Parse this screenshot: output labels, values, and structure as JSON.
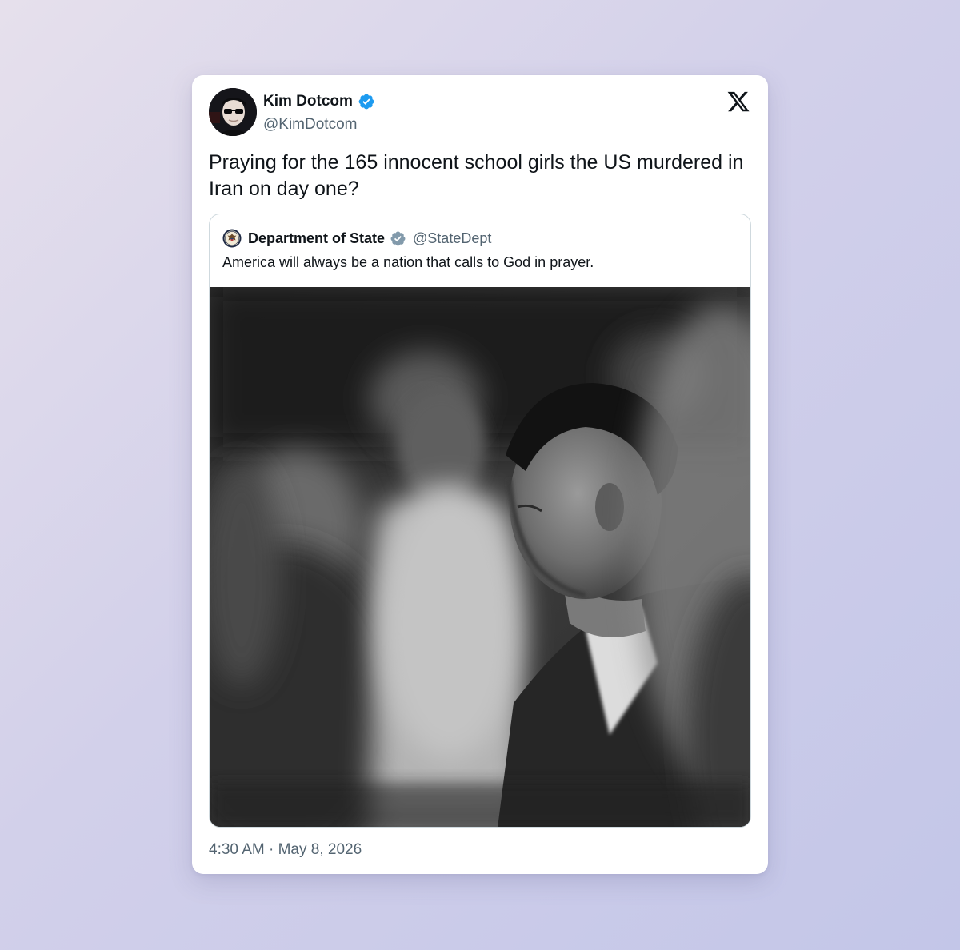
{
  "author": {
    "name": "Kim Dotcom",
    "handle": "@KimDotcom",
    "verified_icon": "verified-badge-blue"
  },
  "platform_logo": "x-logo-icon",
  "tweet": {
    "text": "Praying for the 165 innocent school girls the US murdered in Iran on day one?",
    "timestamp": "4:30 AM · May 8, 2026"
  },
  "quoted_tweet": {
    "name": "Department of State",
    "handle": "@StateDept",
    "verified_icon": "verified-badge-gray",
    "text": "America will always be a nation that calls to God in prayer.",
    "media": "black-and-white-photo-man-bowing-head-in-prayer"
  },
  "colors": {
    "text_primary": "#0f1419",
    "text_secondary": "#536471",
    "verified_blue": "#1d9bf0",
    "verified_gray": "#829aab",
    "border": "#cfd9de"
  }
}
